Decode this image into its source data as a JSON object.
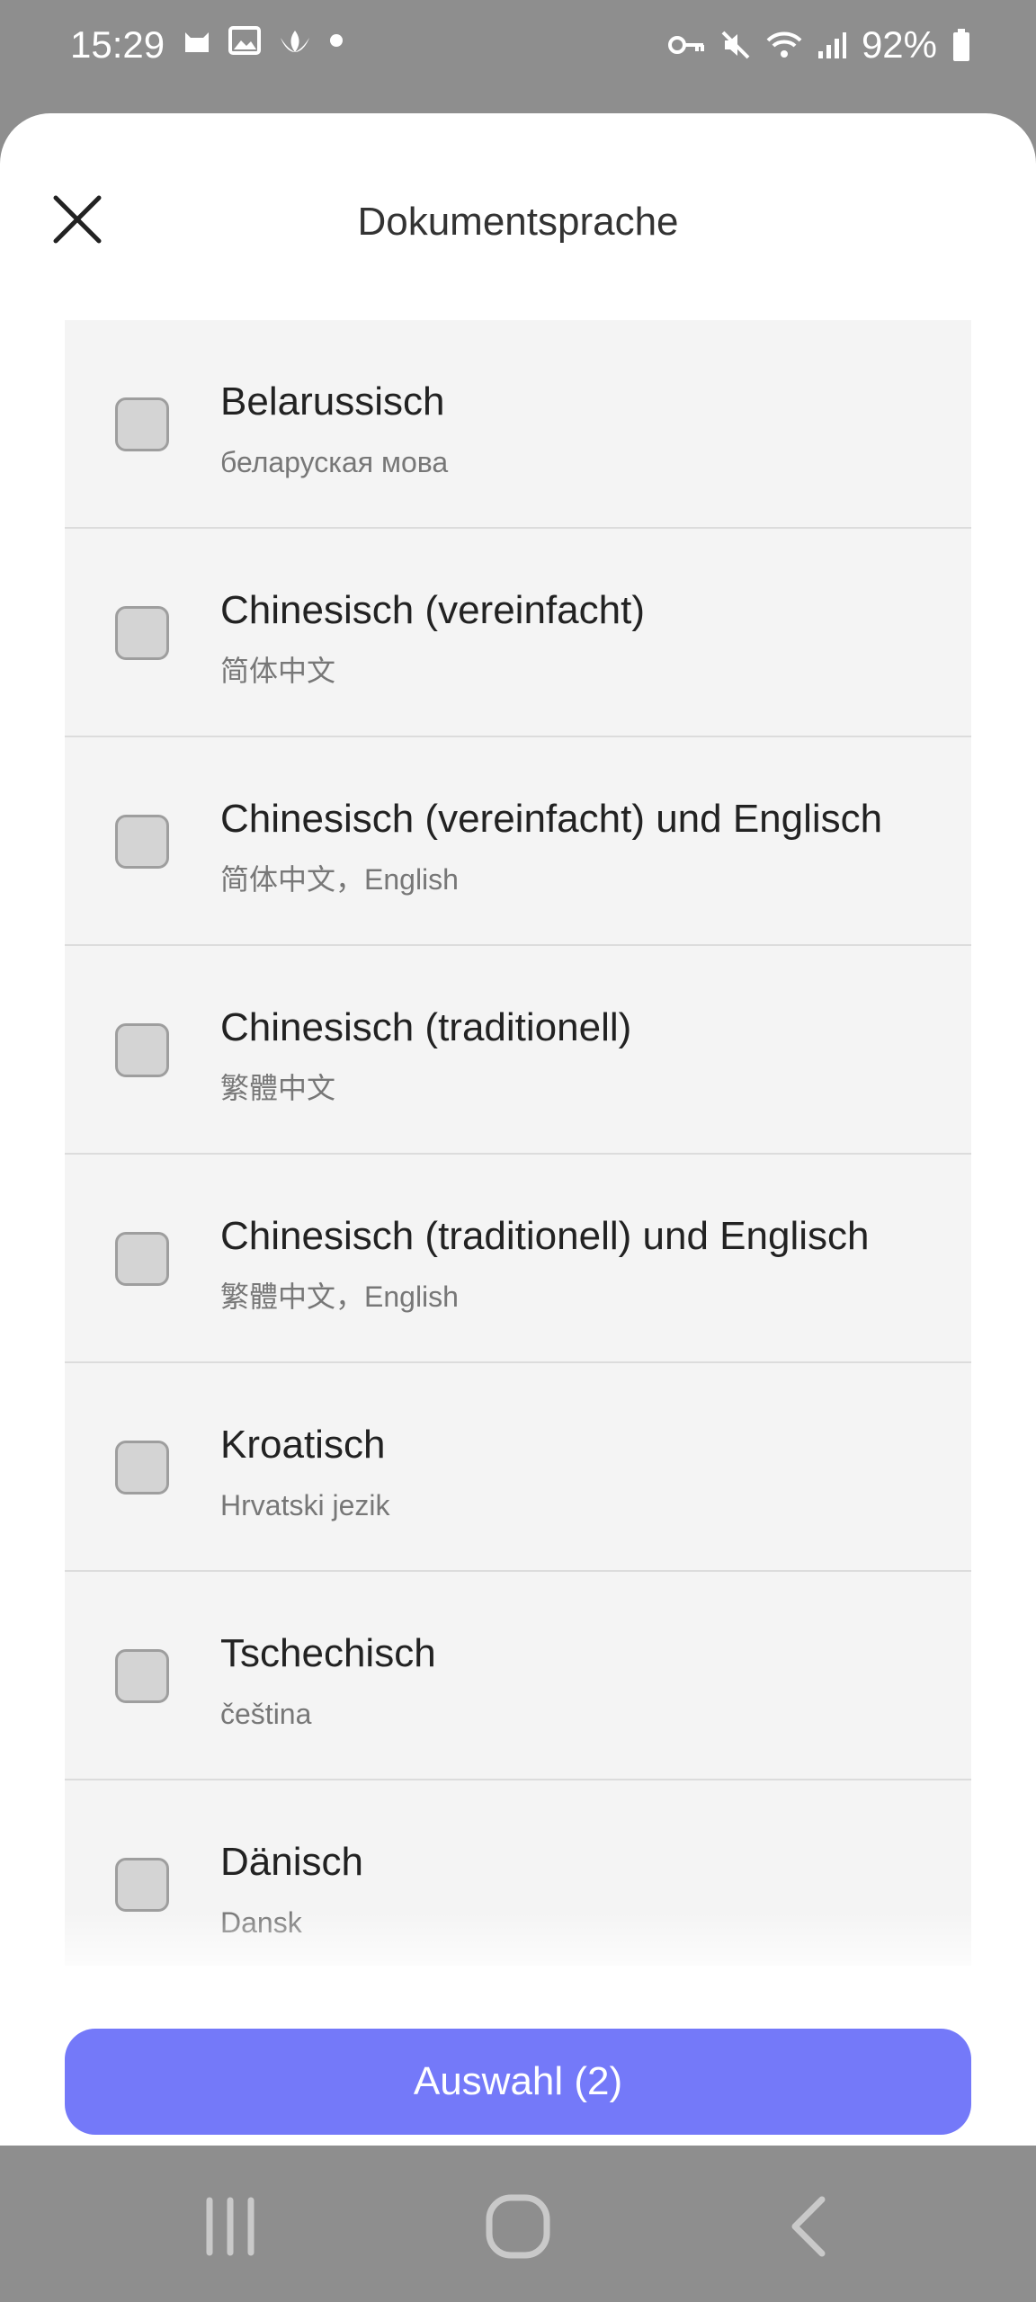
{
  "status_bar": {
    "time": "15:29",
    "battery": "92%",
    "left_icons": [
      "cat-notification-icon",
      "image-icon",
      "lotus-icon",
      "dot-icon"
    ],
    "right_icons": [
      "vpn-key-icon",
      "mute-icon",
      "wifi-icon",
      "signal-icon",
      "battery-icon"
    ]
  },
  "sheet": {
    "title": "Dokumentsprache"
  },
  "languages": [
    {
      "name": "Belarussisch",
      "native": "беларуская мова",
      "checked": false
    },
    {
      "name": "Chinesisch (vereinfacht)",
      "native": "简体中文",
      "checked": false
    },
    {
      "name": "Chinesisch (vereinfacht) und Englisch",
      "native": "简体中文，English",
      "checked": false
    },
    {
      "name": "Chinesisch (traditionell)",
      "native": "繁體中文",
      "checked": false
    },
    {
      "name": "Chinesisch (traditionell) und Englisch",
      "native": "繁體中文，English",
      "checked": false
    },
    {
      "name": "Kroatisch",
      "native": "Hrvatski jezik",
      "checked": false
    },
    {
      "name": "Tschechisch",
      "native": "čeština",
      "checked": false
    },
    {
      "name": "Dänisch",
      "native": "Dansk",
      "checked": false
    }
  ],
  "footer": {
    "select_label": "Auswahl (2)"
  },
  "colors": {
    "accent": "#7479f9",
    "scrim": "#8e8e8e",
    "list_background": "#f4f4f4"
  }
}
